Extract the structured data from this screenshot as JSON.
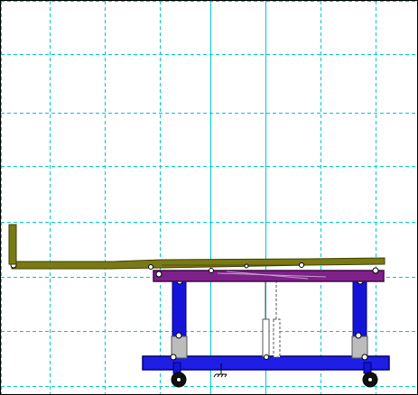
{
  "viewport": {
    "name": "mechanism-drawing-viewport"
  },
  "colors": {
    "background": "#ffffff",
    "grid": "#00c8c8",
    "deck": "#7a7a14",
    "deck_dark": "#3e3e06",
    "frame": "#80208a",
    "frame_dark": "#3c0a44",
    "lift_column": "#1414d8",
    "lift_column_dark": "#000070",
    "column_sleeve": "#bcbcbc",
    "base": "#1e1ee6",
    "base_dark": "#000070",
    "wheel": "#101010",
    "pivot": "#ffffff",
    "actuator": "#707070"
  },
  "grid": {
    "style": "dashed",
    "visible": true
  },
  "parts": [
    "table-top-deck",
    "head-end-post",
    "purple-frame",
    "left-lift-column",
    "right-lift-column",
    "center-actuator",
    "blue-base",
    "left-caster-wheel",
    "right-caster-wheel",
    "center-anchor-icon"
  ]
}
